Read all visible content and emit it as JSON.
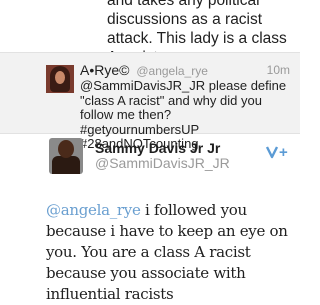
{
  "previous_tweet": {
    "text": "and takes any political discussions as a racist attack. This lady is a class A racist"
  },
  "reply": {
    "name": "A•Rye©",
    "handle": "@angela_rye",
    "time": "10m",
    "text": "@SammiDavisJR_JR please define \"class A racist\" and why did you follow me then? #getyournumbersUP #28andNOTcounting"
  },
  "main_tweet": {
    "name": "Sammy Davis Jr Jr",
    "handle": "@SammiDavisJR_JR",
    "service_icon": "google-plus-icon",
    "service_label": "+",
    "mention": "@angela_rye",
    "text": " i followed you because i have to keep an eye on you. You are a class A racist because you associate with influential racists"
  },
  "colors": {
    "link": "#6a9fd0",
    "muted": "#9a9a9a",
    "card_bg": "#f2f2f2",
    "gplus": "#5b9bd5"
  }
}
